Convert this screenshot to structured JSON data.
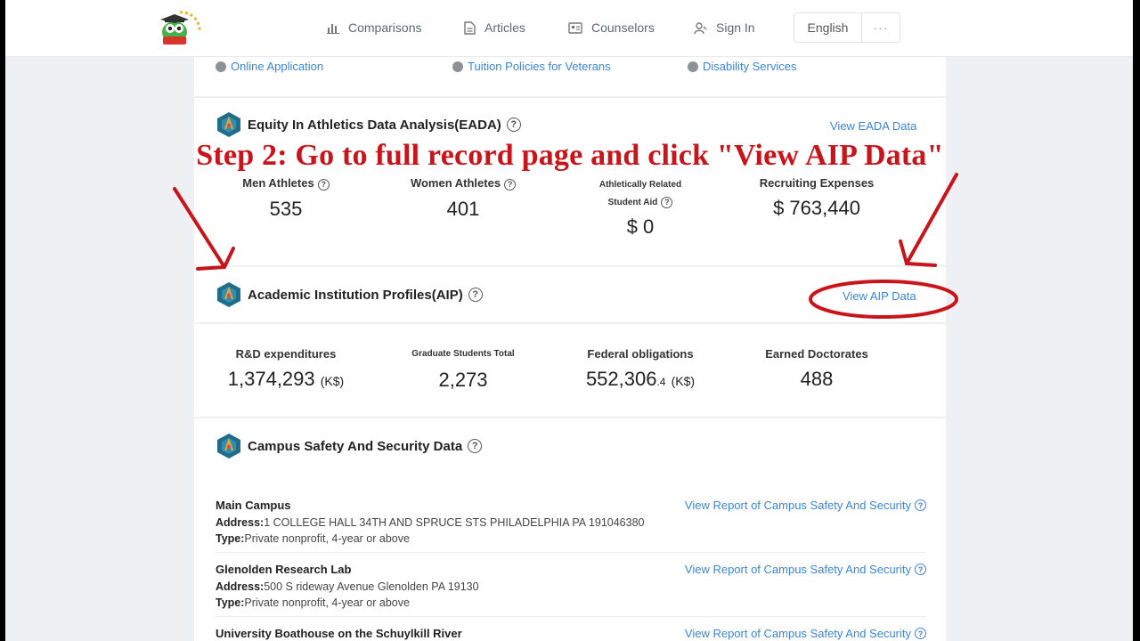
{
  "nav": {
    "items": [
      {
        "label": "Comparisons",
        "icon": "bar-chart-icon"
      },
      {
        "label": "Articles",
        "icon": "document-icon"
      },
      {
        "label": "Counselors",
        "icon": "id-card-icon"
      },
      {
        "label": "Sign In",
        "icon": "user-icon"
      }
    ],
    "language": "English",
    "more": "···"
  },
  "top_links": [
    "Online Application",
    "Tuition Policies for Veterans",
    "Disability Services"
  ],
  "eada": {
    "title": "Equity In Athletics Data Analysis(EADA)",
    "view_link": "View EADA Data",
    "stats": [
      {
        "label": "Men Athletes",
        "value": "535"
      },
      {
        "label": "Women Athletes",
        "value": "401"
      },
      {
        "label_line1": "Athletically Related",
        "label_line2": "Student Aid",
        "value": "$ 0"
      },
      {
        "label": "Recruiting Expenses",
        "value": "$ 763,440"
      }
    ]
  },
  "annotation": "Step 2: Go to full record page and click \"View AIP Data\"",
  "aip": {
    "title": "Academic Institution Profiles(AIP)",
    "view_link": "View AIP Data",
    "stats": [
      {
        "label": "R&D expenditures",
        "value": "1,374,293",
        "unit": "(K$)"
      },
      {
        "label": "Graduate Students Total",
        "value": "2,273"
      },
      {
        "label": "Federal obligations",
        "value": "552,306",
        "decimal": ".4",
        "unit": "(K$)"
      },
      {
        "label": "Earned Doctorates",
        "value": "488"
      }
    ]
  },
  "safety": {
    "title": "Campus Safety And Security Data",
    "address_label": "Address",
    "type_label": "Type",
    "link_label": "View Report of Campus Safety And Security",
    "campuses": [
      {
        "name": "Main Campus",
        "address": "1 COLLEGE HALL 34TH AND SPRUCE STS PHILADELPHIA PA 191046380",
        "type": "Private nonprofit, 4-year or above"
      },
      {
        "name": "Glenolden Research Lab",
        "address": "500 S rideway Avenue Glenolden PA 19130",
        "type": "Private nonprofit, 4-year or above"
      },
      {
        "name": "University Boathouse on the Schuylkill River"
      }
    ]
  },
  "colors": {
    "accent": "#3b86d6",
    "annotation": "#c8141b"
  }
}
